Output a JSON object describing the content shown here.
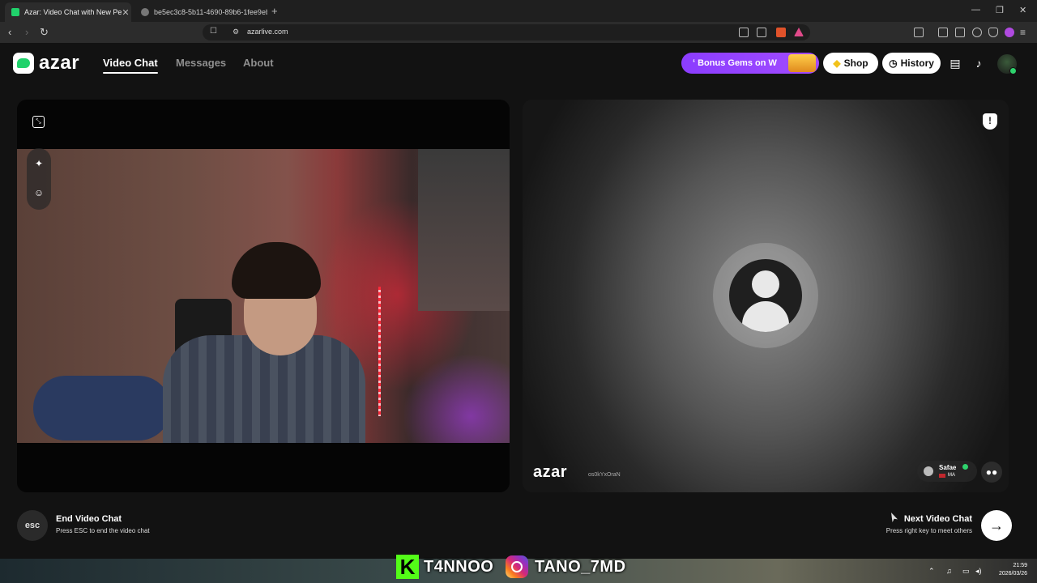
{
  "browser": {
    "tabs": [
      {
        "title": "Azar: Video Chat with New Pe",
        "active": true
      },
      {
        "title": "be5ec3c8-5b11-4690-89b6-1fee9eb",
        "active": false
      }
    ],
    "new_tab": "+",
    "url": "azarlive.com"
  },
  "header": {
    "logo": "azar",
    "nav": [
      {
        "label": "Video Chat",
        "active": true
      },
      {
        "label": "Messages",
        "active": false
      },
      {
        "label": "About",
        "active": false
      }
    ],
    "promo_label": "ʻ Bonus Gems on W",
    "shop_label": "Shop",
    "history_label": "History"
  },
  "peer": {
    "watermark_logo": "azar",
    "watermark_id": "os0kYxOraN",
    "name": "Safae",
    "country": "MA"
  },
  "controls": {
    "esc_label": "esc",
    "end_title": "End Video Chat",
    "end_sub": "Press ESC to end the video chat",
    "next_title": "Next Video Chat",
    "next_sub": "Press right key to meet others"
  },
  "overlay": {
    "kick_name": "T4NNOO",
    "insta_name": "TANO_7MD",
    "kick_letter": "K"
  },
  "taskbar": {
    "time": "21:59",
    "date": "2026/03/26"
  },
  "colors": {
    "accent_green": "#20d26b",
    "promo_purple": "#8b3dff",
    "background": "#121212"
  }
}
